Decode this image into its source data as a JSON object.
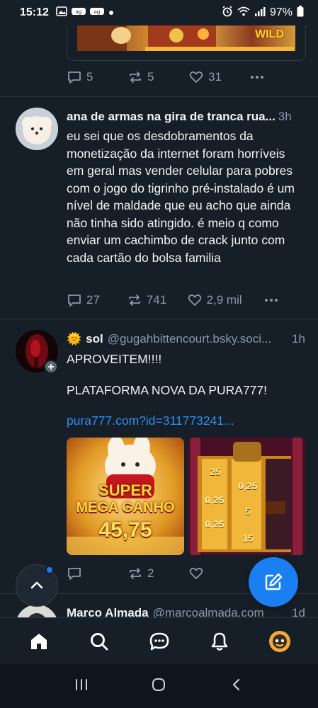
{
  "status_bar": {
    "time": "15:12",
    "battery": "97%"
  },
  "top_post": {
    "image_text": "WILD",
    "replies": "5",
    "reposts": "5",
    "likes": "31"
  },
  "post1": {
    "author": "ana de armas na gira de tranca rua...",
    "time": "3h",
    "text": "eu sei que os desdobramentos da monetização da internet foram horríveis em geral mas vender celular para pobres com o jogo do tigrinho pré-instalado é um nível de maldade que eu acho que ainda não tinha sido atingido. é meio q como enviar um cachimbo de crack junto com cada cartão do bolsa familia",
    "replies": "27",
    "reposts": "741",
    "likes": "2,9 mil"
  },
  "post2": {
    "emoji": "🌞",
    "author": "sol",
    "handle": "@gugahbittencourt.bsky.soci...",
    "time": "1h",
    "line1": "APROVEITEM!!!!",
    "line2": "PLATAFORMA NOVA DA PURA777!",
    "link": "pura777.com?id=311773241...",
    "image1_line1": "SUPER",
    "image1_line2": "MEGA GANHO",
    "image1_amount": "45,75",
    "image2_values": [
      "25",
      "0,25",
      "0,25",
      "5",
      "0,25",
      "15"
    ],
    "reposts": "2"
  },
  "post3": {
    "author": "Marco Almada",
    "handle": "@marcoalmada.com",
    "time": "1d"
  },
  "icons": {
    "reply": "speech-bubble-icon",
    "repost": "repost-arrows-icon",
    "like": "heart-icon",
    "more": "ellipsis-icon",
    "home": "home-icon",
    "search": "search-icon",
    "chat": "chat-icon",
    "notifications": "bell-icon",
    "compose": "compose-icon",
    "scroll_top": "chevron-up-icon"
  },
  "colors": {
    "background": "#161e27",
    "accent": "#1a7ff0",
    "muted": "#8a99ab",
    "link": "#2f8ff5"
  }
}
